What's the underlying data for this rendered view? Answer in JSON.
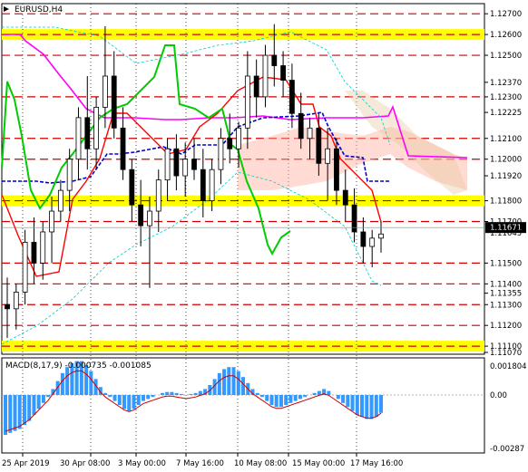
{
  "chart_title": "EURUSD,H4",
  "macd_label": "MACD(8,17,9) -0.000735 -0.001085",
  "price_levels": [
    {
      "label": "1.12700",
      "value": 1.127,
      "style": "dash"
    },
    {
      "label": "1.12600",
      "value": 1.126,
      "style": "zone"
    },
    {
      "label": "1.12500",
      "value": 1.125,
      "style": "dash"
    },
    {
      "label": "1.12370",
      "value": 1.1237,
      "style": "none"
    },
    {
      "label": "1.12300",
      "value": 1.123,
      "style": "dash"
    },
    {
      "label": "1.12225",
      "value": 1.12225,
      "style": "none"
    },
    {
      "label": "1.12100",
      "value": 1.121,
      "style": "dash"
    },
    {
      "label": "1.12000",
      "value": 1.12,
      "style": "dash"
    },
    {
      "label": "1.11920",
      "value": 1.1192,
      "style": "none"
    },
    {
      "label": "1.11800",
      "value": 1.118,
      "style": "zone"
    },
    {
      "label": "1.11700",
      "value": 1.117,
      "style": "dash"
    },
    {
      "label": "1.11500",
      "value": 1.115,
      "style": "dash"
    },
    {
      "label": "1.11400",
      "value": 1.114,
      "style": "dash"
    },
    {
      "label": "1.11355",
      "value": 1.11355,
      "style": "none"
    },
    {
      "label": "1.11300",
      "value": 1.113,
      "style": "dash"
    },
    {
      "label": "1.11200",
      "value": 1.112,
      "style": "dash"
    },
    {
      "label": "1.11100",
      "value": 1.111,
      "style": "zone"
    },
    {
      "label": "1.11070",
      "value": 1.1107,
      "style": "none"
    }
  ],
  "current_price": {
    "label": "1.11671",
    "value": 1.11671
  },
  "extra_labels": [
    {
      "label": "1.11645",
      "value": 1.11645
    }
  ],
  "macd_axis": [
    {
      "label": "0.001804",
      "value": 0.001804
    },
    {
      "label": "0.00",
      "value": 0.0
    },
    {
      "label": "-0.00287",
      "value": -0.00287
    }
  ],
  "x_labels": [
    "25 Apr 2019",
    "30 Apr 08:00",
    "3 May 00:00",
    "7 May 16:00",
    "10 May 08:00",
    "15 May 00:00",
    "17 May 16:00"
  ],
  "colors": {
    "zone": "#ffff00",
    "dash": "#cc0000",
    "tenkan": "#ff0000",
    "kijun": "#0000cc",
    "chikou": "#00cc00",
    "senkou_b": "#ff00ff",
    "bands": "#00cccc",
    "macd_hist": "#3399ff",
    "macd_signal": "#cc0000",
    "cloud": "#ffb0a0",
    "cloud2": "#e8c8a0"
  },
  "chart_data": {
    "type": "candlestick",
    "symbol": "EURUSD",
    "timeframe": "H4",
    "ylim": [
      1.1107,
      1.1274
    ],
    "candles": [
      [
        1.113,
        1.1143,
        1.1114,
        1.1128
      ],
      [
        1.1128,
        1.114,
        1.1118,
        1.1136
      ],
      [
        1.1136,
        1.1166,
        1.113,
        1.116
      ],
      [
        1.116,
        1.1172,
        1.114,
        1.115
      ],
      [
        1.115,
        1.117,
        1.1142,
        1.1165
      ],
      [
        1.1165,
        1.1182,
        1.115,
        1.1175
      ],
      [
        1.1175,
        1.119,
        1.117,
        1.1185
      ],
      [
        1.1185,
        1.1205,
        1.1175,
        1.12
      ],
      [
        1.12,
        1.1225,
        1.119,
        1.122
      ],
      [
        1.122,
        1.124,
        1.1195,
        1.1205
      ],
      [
        1.1205,
        1.123,
        1.1195,
        1.1225
      ],
      [
        1.1225,
        1.1264,
        1.1215,
        1.124
      ],
      [
        1.124,
        1.1252,
        1.121,
        1.1215
      ],
      [
        1.1215,
        1.1225,
        1.119,
        1.1195
      ],
      [
        1.1195,
        1.12,
        1.117,
        1.1178
      ],
      [
        1.1178,
        1.119,
        1.1158,
        1.1168
      ],
      [
        1.1168,
        1.1182,
        1.1138,
        1.1175
      ],
      [
        1.1175,
        1.1195,
        1.1165,
        1.119
      ],
      [
        1.119,
        1.121,
        1.118,
        1.1205
      ],
      [
        1.1205,
        1.1212,
        1.1185,
        1.1192
      ],
      [
        1.1192,
        1.1208,
        1.1182,
        1.12
      ],
      [
        1.12,
        1.121,
        1.119,
        1.1195
      ],
      [
        1.1195,
        1.1205,
        1.1172,
        1.118
      ],
      [
        1.118,
        1.12,
        1.1175,
        1.1195
      ],
      [
        1.1195,
        1.1215,
        1.1188,
        1.121
      ],
      [
        1.121,
        1.1222,
        1.1198,
        1.1205
      ],
      [
        1.1205,
        1.1218,
        1.1196,
        1.1215
      ],
      [
        1.1215,
        1.1252,
        1.1205,
        1.124
      ],
      [
        1.124,
        1.1248,
        1.122,
        1.123
      ],
      [
        1.123,
        1.1255,
        1.1225,
        1.125
      ],
      [
        1.125,
        1.1265,
        1.1235,
        1.1245
      ],
      [
        1.1245,
        1.1252,
        1.123,
        1.1238
      ],
      [
        1.1238,
        1.1246,
        1.1215,
        1.1222
      ],
      [
        1.1222,
        1.1232,
        1.1205,
        1.121
      ],
      [
        1.121,
        1.122,
        1.12,
        1.1215
      ],
      [
        1.1215,
        1.1222,
        1.1192,
        1.1198
      ],
      [
        1.1198,
        1.1215,
        1.118,
        1.1205
      ],
      [
        1.1205,
        1.121,
        1.1178,
        1.1185
      ],
      [
        1.1185,
        1.1195,
        1.117,
        1.1178
      ],
      [
        1.1178,
        1.1186,
        1.116,
        1.1165
      ],
      [
        1.1165,
        1.1172,
        1.115,
        1.1158
      ],
      [
        1.1158,
        1.1166,
        1.1148,
        1.1162
      ],
      [
        1.1162,
        1.117,
        1.1155,
        1.1164
      ]
    ]
  }
}
